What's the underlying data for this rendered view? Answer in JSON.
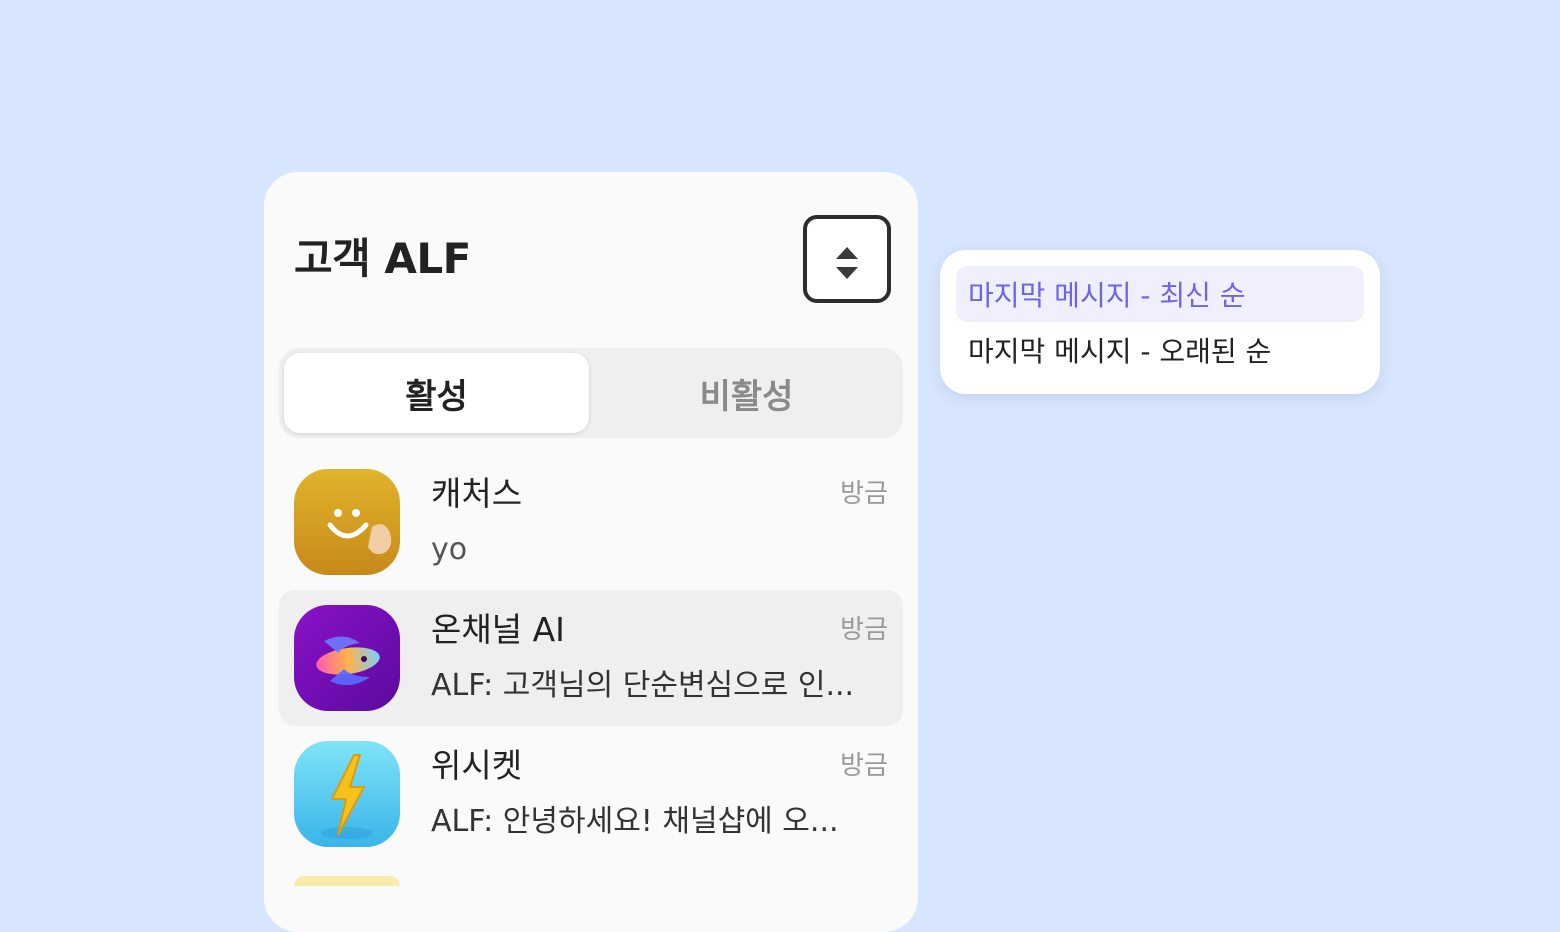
{
  "header": {
    "title": "고객 ALF",
    "sort_icon": "sort-up-down-icon"
  },
  "tabs": [
    {
      "label": "활성",
      "active": true
    },
    {
      "label": "비활성",
      "active": false
    }
  ],
  "chats": [
    {
      "name": "캐처스",
      "time": "방금",
      "preview": "yo",
      "avatar": "smiley-icon",
      "highlighted": false
    },
    {
      "name": "온채널 AI",
      "time": "방금",
      "preview": "ALF: 고객님의 단순변심으로 인...",
      "avatar": "swirl-fish-icon",
      "highlighted": true
    },
    {
      "name": "위시켓",
      "time": "방금",
      "preview": "ALF: 안녕하세요! 채널샵에 오...",
      "avatar": "lightning-icon",
      "highlighted": false
    }
  ],
  "sort_menu": {
    "options": [
      {
        "label": "마지막 메시지 - 최신 순",
        "selected": true
      },
      {
        "label": "마지막 메시지 - 오래된 순",
        "selected": false
      }
    ]
  },
  "colors": {
    "background": "#d7e5fe",
    "accent": "#6f63e8",
    "selected_bg": "#efeffd"
  }
}
